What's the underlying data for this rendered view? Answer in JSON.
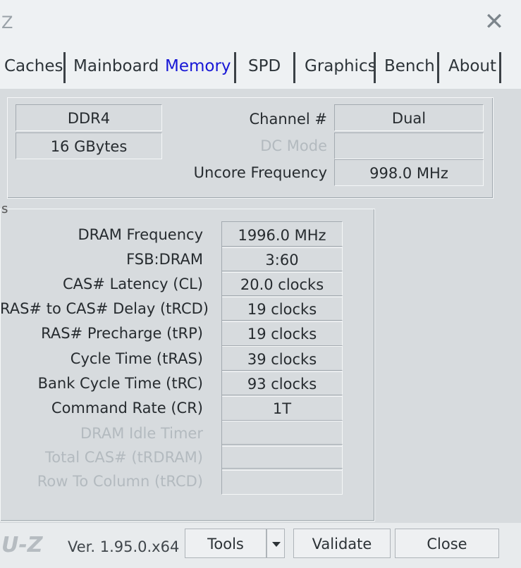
{
  "window": {
    "title_fragment": "Z",
    "close_glyph": "✕"
  },
  "tabs": [
    {
      "label": "Caches"
    },
    {
      "label": "Mainboard"
    },
    {
      "label": "Memory",
      "active": true
    },
    {
      "label": "SPD"
    },
    {
      "label": "Graphics"
    },
    {
      "label": "Bench"
    },
    {
      "label": "About"
    }
  ],
  "general": {
    "type": "DDR4",
    "size": "16 GBytes",
    "channel_label": "Channel #",
    "channel_value": "Dual",
    "dc_mode_label": "DC Mode",
    "dc_mode_value": "",
    "uncore_label": "Uncore Frequency",
    "uncore_value": "998.0 MHz"
  },
  "timings": {
    "section_glyph": "s",
    "rows": [
      {
        "label": "DRAM Frequency",
        "value": "1996.0 MHz",
        "enabled": true
      },
      {
        "label": "FSB:DRAM",
        "value": "3:60",
        "enabled": true
      },
      {
        "label": "CAS# Latency (CL)",
        "value": "20.0 clocks",
        "enabled": true
      },
      {
        "label": "RAS# to CAS# Delay (tRCD)",
        "value": "19 clocks",
        "enabled": true
      },
      {
        "label": "RAS# Precharge (tRP)",
        "value": "19 clocks",
        "enabled": true
      },
      {
        "label": "Cycle Time (tRAS)",
        "value": "39 clocks",
        "enabled": true
      },
      {
        "label": "Bank Cycle Time (tRC)",
        "value": "93 clocks",
        "enabled": true
      },
      {
        "label": "Command Rate (CR)",
        "value": "1T",
        "enabled": true
      },
      {
        "label": "DRAM Idle Timer",
        "value": "",
        "enabled": false
      },
      {
        "label": "Total CAS# (tRDRAM)",
        "value": "",
        "enabled": false
      },
      {
        "label": "Row To Column (tRCD)",
        "value": "",
        "enabled": false
      }
    ]
  },
  "footer": {
    "logo": "U-Z",
    "version": "Ver. 1.95.0.x64",
    "tools_label": "Tools",
    "validate_label": "Validate",
    "close_label": "Close"
  }
}
